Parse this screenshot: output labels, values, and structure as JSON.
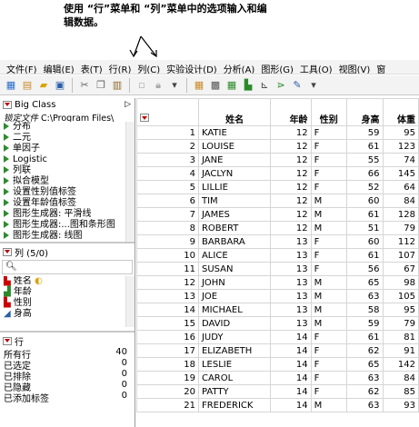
{
  "callout": {
    "text": "使用 “行”菜单和 “列”菜单中的选项输入和编辑数据。"
  },
  "menu": [
    "文件(F)",
    "编辑(E)",
    "表(T)",
    "行(R)",
    "列(C)",
    "实验设计(D)",
    "分析(A)",
    "图形(G)",
    "工具(O)",
    "视图(V)",
    "窗"
  ],
  "left_panel": {
    "table_title": "Big Class",
    "locked_file_label": "锁定文件",
    "locked_file_path": "C:\\Program Files\\",
    "scripts": [
      "分布",
      "二元",
      "单因子",
      "Logistic",
      "列联",
      "拟合模型",
      "设置性别值标签",
      "设置年龄值标签",
      "图形生成器: 平滑线",
      "图形生成器:...图和条形图",
      "图形生成器: 线图"
    ],
    "columns_header": "列 (5/0)",
    "columns": [
      "姓名",
      "年龄",
      "性别",
      "身高"
    ],
    "rows_header": "行",
    "rows_stats": [
      {
        "label": "所有行",
        "value": "40"
      },
      {
        "label": "已选定",
        "value": "0"
      },
      {
        "label": "已排除",
        "value": "0"
      },
      {
        "label": "已隐藏",
        "value": "0"
      },
      {
        "label": "已添加标签",
        "value": "0"
      }
    ]
  },
  "table": {
    "headers": [
      "姓名",
      "年龄",
      "性别",
      "身高",
      "体重"
    ],
    "rows": [
      [
        "1",
        "KATIE",
        "12",
        "F",
        "59",
        "95"
      ],
      [
        "2",
        "LOUISE",
        "12",
        "F",
        "61",
        "123"
      ],
      [
        "3",
        "JANE",
        "12",
        "F",
        "55",
        "74"
      ],
      [
        "4",
        "JACLYN",
        "12",
        "F",
        "66",
        "145"
      ],
      [
        "5",
        "LILLIE",
        "12",
        "F",
        "52",
        "64"
      ],
      [
        "6",
        "TIM",
        "12",
        "M",
        "60",
        "84"
      ],
      [
        "7",
        "JAMES",
        "12",
        "M",
        "61",
        "128"
      ],
      [
        "8",
        "ROBERT",
        "12",
        "M",
        "51",
        "79"
      ],
      [
        "9",
        "BARBARA",
        "13",
        "F",
        "60",
        "112"
      ],
      [
        "10",
        "ALICE",
        "13",
        "F",
        "61",
        "107"
      ],
      [
        "11",
        "SUSAN",
        "13",
        "F",
        "56",
        "67"
      ],
      [
        "12",
        "JOHN",
        "13",
        "M",
        "65",
        "98"
      ],
      [
        "13",
        "JOE",
        "13",
        "M",
        "63",
        "105"
      ],
      [
        "14",
        "MICHAEL",
        "13",
        "M",
        "58",
        "95"
      ],
      [
        "15",
        "DAVID",
        "13",
        "M",
        "59",
        "79"
      ],
      [
        "16",
        "JUDY",
        "14",
        "F",
        "61",
        "81"
      ],
      [
        "17",
        "ELIZABETH",
        "14",
        "F",
        "62",
        "91"
      ],
      [
        "18",
        "LESLIE",
        "14",
        "F",
        "65",
        "142"
      ],
      [
        "19",
        "CAROL",
        "14",
        "F",
        "63",
        "84"
      ],
      [
        "20",
        "PATTY",
        "14",
        "F",
        "62",
        "85"
      ],
      [
        "21",
        "FREDERICK",
        "14",
        "M",
        "63",
        "93"
      ]
    ]
  }
}
